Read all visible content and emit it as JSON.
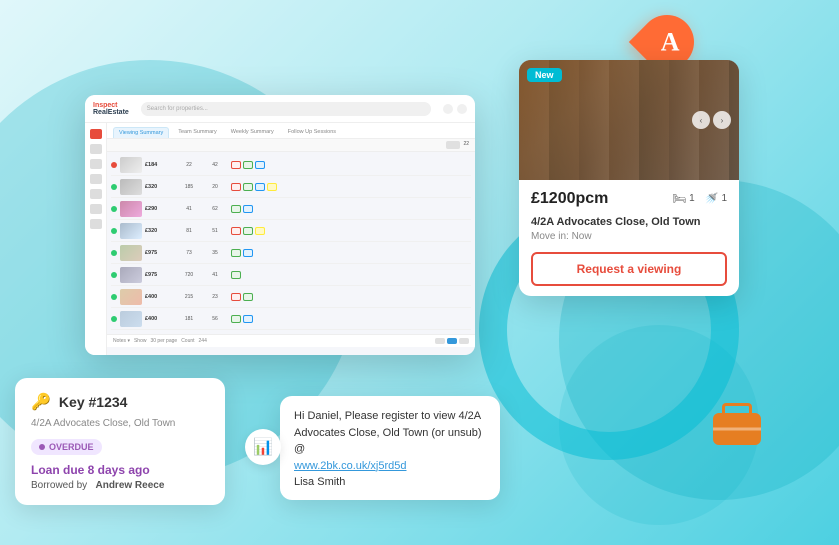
{
  "app": {
    "title": "Inspect Real Estate",
    "search_placeholder": "Search for properties...",
    "tabs": [
      {
        "label": "Viewing Summary",
        "active": true
      },
      {
        "label": "Team Summary",
        "active": false
      },
      {
        "label": "Weekly Summary",
        "active": false
      },
      {
        "label": "Follow Up Sessions",
        "active": false
      }
    ],
    "table": {
      "rows": [
        {
          "price": "£184",
          "col1": "22",
          "col2": "42"
        },
        {
          "price": "£320",
          "col1": "185",
          "col2": "20"
        },
        {
          "price": "£290",
          "col1": "41",
          "col2": "62"
        },
        {
          "price": "£320",
          "col1": "81",
          "col2": "51"
        },
        {
          "price": "£975",
          "col1": "73",
          "col2": "35"
        },
        {
          "price": "£975",
          "col1": "720",
          "col2": "41"
        },
        {
          "price": "£400",
          "col1": "215",
          "col2": "23"
        },
        {
          "price": "£400",
          "col1": "181",
          "col2": "56"
        }
      ]
    },
    "pagination": {
      "show_label": "Show",
      "per_page": "30 per page",
      "count_label": "Count",
      "count": "244"
    }
  },
  "property_card": {
    "badge": "New",
    "price": "£1200pcm",
    "beds": "1",
    "baths": "1",
    "address": "4/2A Advocates Close, Old Town",
    "move_in_label": "Move in:",
    "move_in_value": "Now",
    "cta_label": "Request a viewing"
  },
  "key_card": {
    "key_number": "Key #1234",
    "address": "4/2A Advocates Close, Old Town",
    "status_badge": "OVERDUE",
    "loan_due_text": "Loan due 8 days ago",
    "borrowed_label": "Borrowed by",
    "borrowed_by": "Andrew Reece"
  },
  "sms_card": {
    "message": "Hi Daniel, Please register to view 4/2A Advocates Close, Old Town (or unsub) @",
    "link_text": "www.2bk.co.uk/xj5rd5d",
    "link_url": "www.2bk.co.uk/xj5rd5d",
    "sender": "Lisa Smith"
  },
  "logo": {
    "letter": "A"
  },
  "colors": {
    "primary_red": "#e74c3c",
    "primary_blue": "#3498db",
    "teal": "#00bcd4",
    "purple": "#9b59b6",
    "orange": "#e67e22",
    "new_badge": "#00bcd4"
  }
}
